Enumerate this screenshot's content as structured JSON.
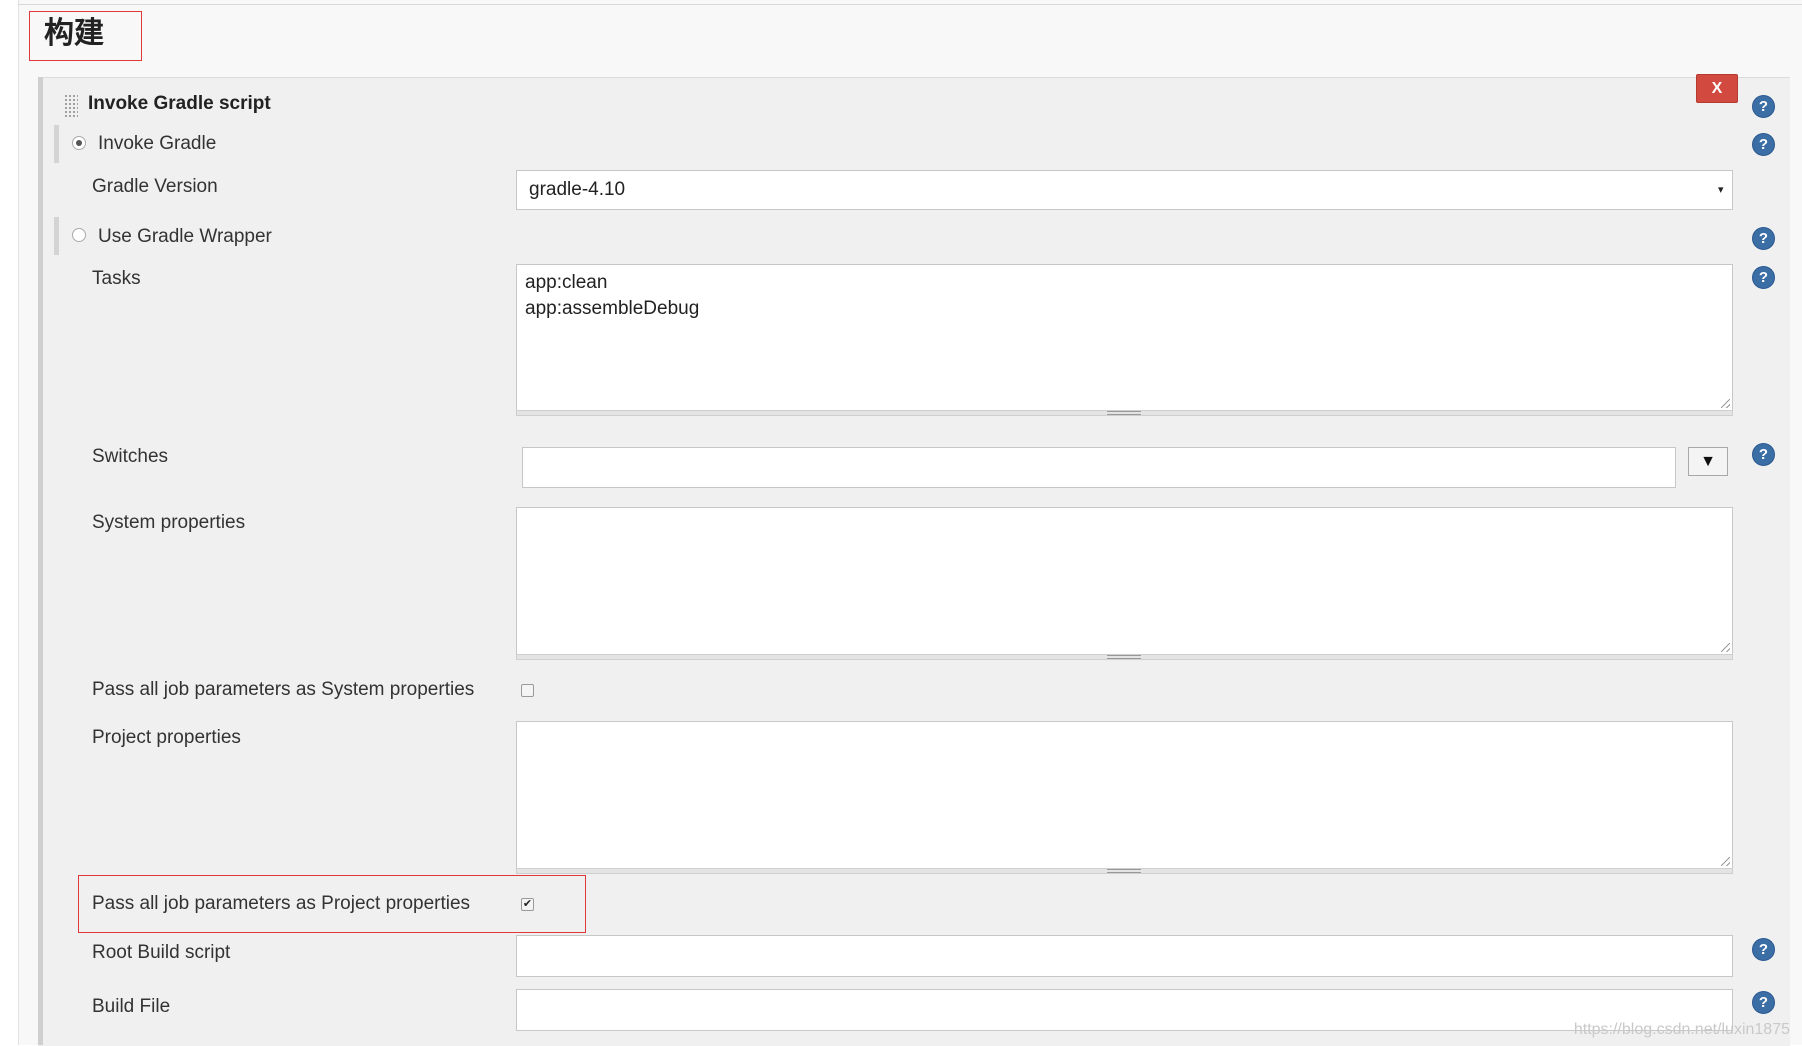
{
  "section": {
    "title": "构建"
  },
  "step": {
    "title": "Invoke Gradle script",
    "delete_label": "X",
    "help_glyph": "?"
  },
  "invoke_gradle": {
    "label": "Invoke Gradle",
    "selected": true
  },
  "gradle_version": {
    "label": "Gradle Version",
    "value": "gradle-4.10",
    "arrow": "▾"
  },
  "use_wrapper": {
    "label": "Use Gradle Wrapper",
    "selected": false
  },
  "tasks": {
    "label": "Tasks",
    "value": "app:clean\napp:assembleDebug"
  },
  "switches": {
    "label": "Switches",
    "value": "",
    "button_label": "▼"
  },
  "system_properties": {
    "label": "System properties",
    "value": ""
  },
  "pass_system": {
    "label": "Pass all job parameters as System properties",
    "checked": false
  },
  "project_properties": {
    "label": "Project properties",
    "value": ""
  },
  "pass_project": {
    "label": "Pass all job parameters as Project properties",
    "checked": true,
    "check_glyph": "✔"
  },
  "root_build_script": {
    "label": "Root Build script",
    "value": ""
  },
  "build_file": {
    "label": "Build File",
    "value": ""
  },
  "watermark": "https://blog.csdn.net/luxin1875",
  "colors": {
    "accent_red": "#e0393b",
    "delete_button": "#d24a3f",
    "help_blue": "#3c6ea6"
  },
  "icons": {
    "help": "help-icon",
    "delete": "delete-icon",
    "drag": "drag-handle-icon"
  }
}
